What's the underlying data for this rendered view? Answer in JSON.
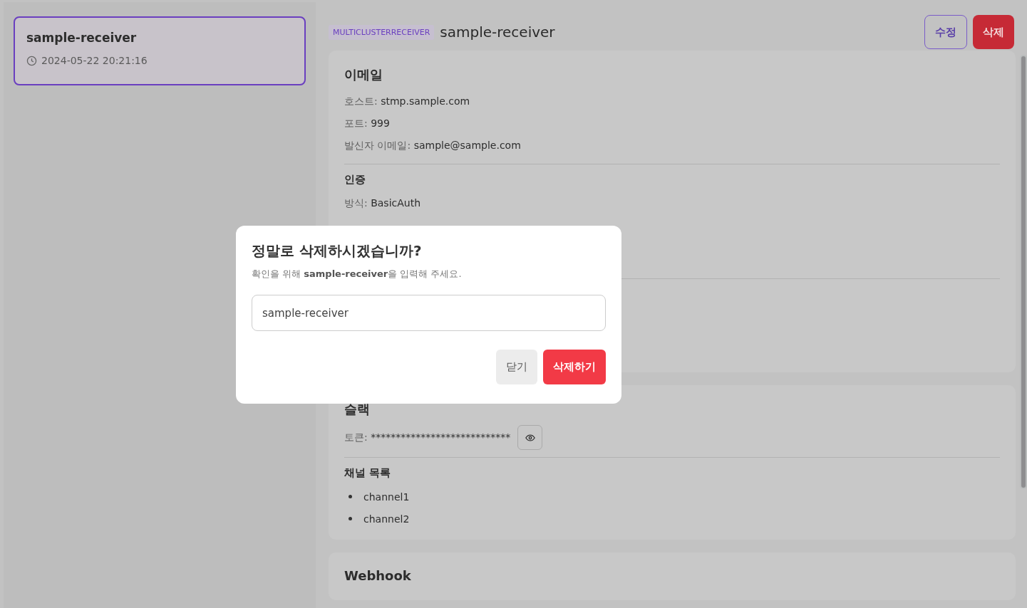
{
  "sidebar": {
    "items": [
      {
        "name": "sample-receiver",
        "timestamp": "2024-05-22 20:21:16",
        "selected": true
      }
    ]
  },
  "header": {
    "kind_badge": "MULTICLUSTERRECEIVER",
    "title": "sample-receiver",
    "buttons": [
      {
        "label": "수정",
        "kind": "outline"
      },
      {
        "label": "삭제",
        "kind": "danger"
      }
    ]
  },
  "cards": [
    {
      "title": "이메일",
      "sections": [
        {
          "fields": [
            {
              "label": "호스트:",
              "value": "stmp.sample.com"
            },
            {
              "label": "포트:",
              "value": "999"
            },
            {
              "label": "발신자 이메일:",
              "value": "sample@sample.com"
            }
          ]
        },
        {
          "title": "인증",
          "fields": [
            {
              "label": "방식:",
              "value": "BasicAuth"
            }
          ]
        }
      ]
    },
    {
      "title": "슬랙",
      "sections": [
        {
          "fields": [
            {
              "label": "토큰:",
              "value": "****************************",
              "masked": true
            }
          ]
        },
        {
          "title": "채널 목록",
          "list": [
            "channel1",
            "channel2"
          ]
        }
      ]
    },
    {
      "title": "Webhook"
    }
  ],
  "dialog": {
    "title": "정말로 삭제하시겠습니까?",
    "message": "확인을 위해 **sample-receiver**을 입력해 주세요.",
    "input_value": "sample-receiver",
    "buttons": [
      {
        "label": "닫기",
        "kind": "secondary"
      },
      {
        "label": "삭제하기",
        "kind": "danger"
      }
    ]
  }
}
